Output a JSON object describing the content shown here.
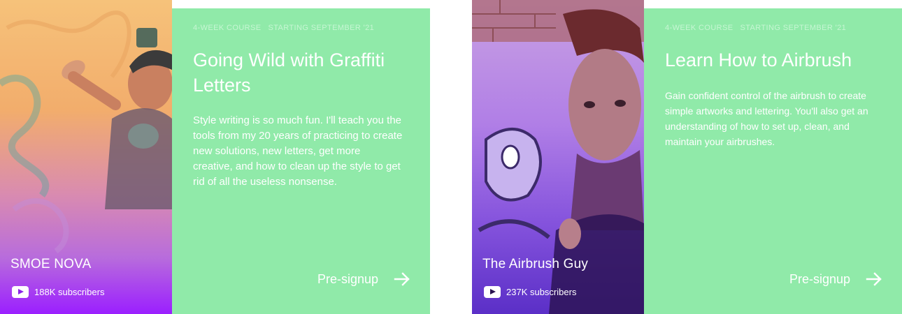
{
  "cards": [
    {
      "creator": "SMOE NOVA",
      "subscribers": "188K subscribers",
      "eyebrow_type": "4-WEEK COURSE",
      "eyebrow_start": "STARTING SEPTEMBER '21",
      "title": "Going Wild with Graffiti Letters",
      "description": "Style writing is so much fun. I'll teach you the tools from my 20 years of practicing to create new solutions, new letters, get more creative, and how to clean up the style to get rid of all the useless nonsense.",
      "cta": "Pre-signup",
      "icons": {
        "platform": "youtube-icon",
        "cta": "arrow-right-icon"
      }
    },
    {
      "creator": "The Airbrush Guy",
      "subscribers": "237K subscribers",
      "eyebrow_type": "4-WEEK COURSE",
      "eyebrow_start": "STARTING SEPTEMBER '21",
      "title": "Learn How to Airbrush",
      "description": "Gain confident control of the airbrush to create simple artworks and lettering. You'll also get an understanding of how to set up, clean, and maintain your airbrushes.",
      "cta": "Pre-signup",
      "icons": {
        "platform": "youtube-icon",
        "cta": "arrow-right-icon"
      }
    }
  ],
  "colors": {
    "panel": "#90eaa9",
    "text": "#ffffff",
    "eyebrow": "#c6f6d3"
  }
}
